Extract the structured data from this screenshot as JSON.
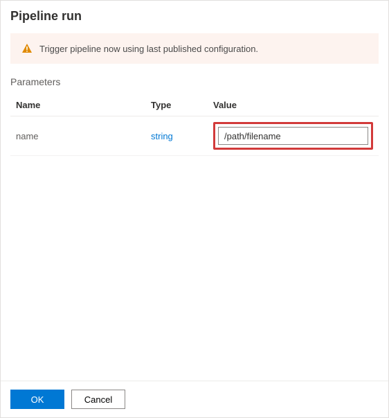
{
  "title": "Pipeline run",
  "banner": {
    "icon": "warning-icon",
    "text": "Trigger pipeline now using last published configuration."
  },
  "parameters": {
    "heading": "Parameters",
    "columns": {
      "name": "Name",
      "type": "Type",
      "value": "Value"
    },
    "rows": [
      {
        "name": "name",
        "type": "string",
        "value": "/path/filename"
      }
    ]
  },
  "footer": {
    "ok": "OK",
    "cancel": "Cancel"
  },
  "highlight_color": "#d23a3a"
}
